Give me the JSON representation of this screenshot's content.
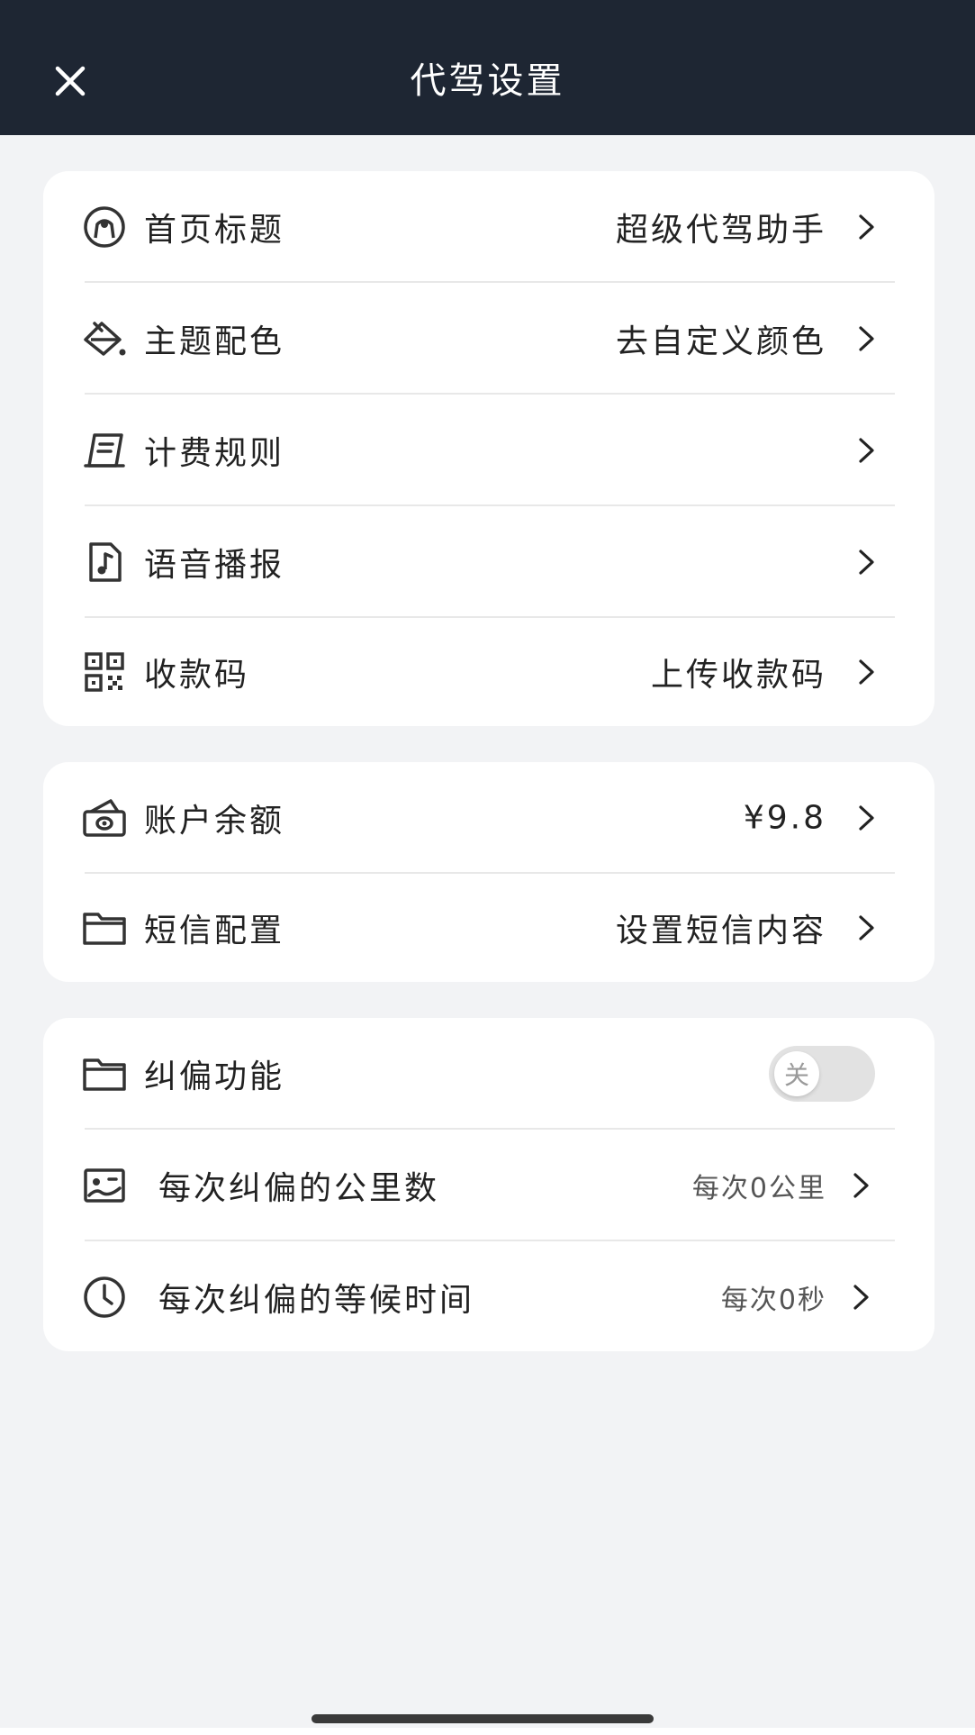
{
  "header": {
    "title": "代驾设置"
  },
  "sections": [
    {
      "rows": [
        {
          "icon": "seat-icon",
          "label": "首页标题",
          "value": "超级代驾助手"
        },
        {
          "icon": "paint-bucket-icon",
          "label": "主题配色",
          "value": "去自定义颜色"
        },
        {
          "icon": "receipt-icon",
          "label": "计费规则",
          "value": ""
        },
        {
          "icon": "audio-file-icon",
          "label": "语音播报",
          "value": ""
        },
        {
          "icon": "qr-code-icon",
          "label": "收款码",
          "value": "上传收款码"
        }
      ]
    },
    {
      "rows": [
        {
          "icon": "cash-icon",
          "label": "账户余额",
          "value": "¥9.8"
        },
        {
          "icon": "folder-icon",
          "label": "短信配置",
          "value": "设置短信内容"
        }
      ]
    },
    {
      "rows": [
        {
          "icon": "folder-icon",
          "label": "纠偏功能",
          "toggle_text": "关",
          "toggle_on": false
        },
        {
          "icon": "map-card-icon",
          "label": "每次纠偏的公里数",
          "value": "每次0公里"
        },
        {
          "icon": "clock-icon",
          "label": "每次纠偏的等候时间",
          "value": "每次0秒"
        }
      ]
    }
  ],
  "colors": {
    "header_bg": "#1e2633",
    "page_bg": "#f2f3f5",
    "card_bg": "#ffffff"
  }
}
